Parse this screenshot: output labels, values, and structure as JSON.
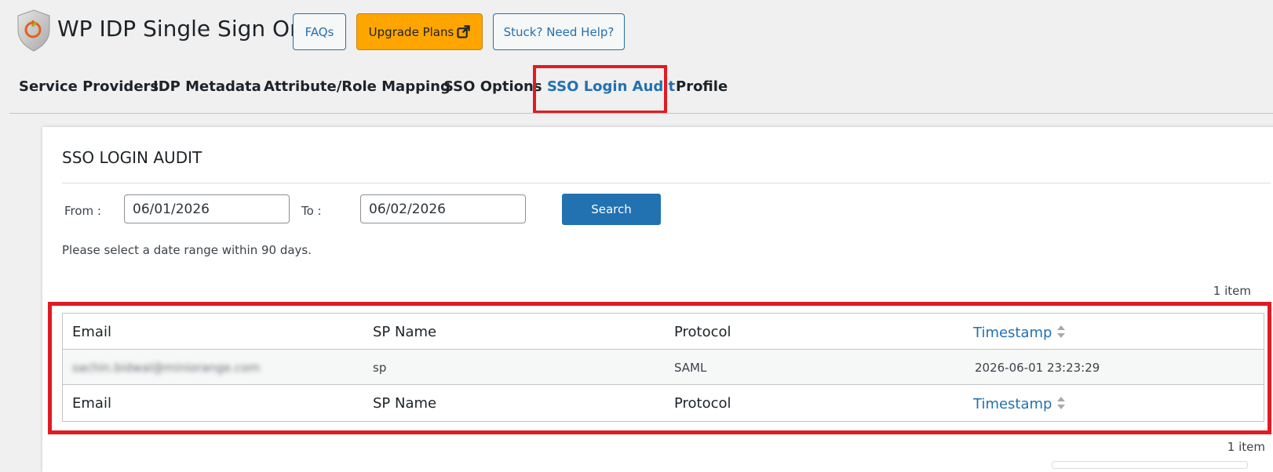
{
  "header": {
    "app_title": "WP IDP Single Sign On",
    "faqs_label": "FAQs",
    "upgrade_label": "Upgrade Plans",
    "help_label": "Stuck? Need Help?",
    "brand_color": "#ffa500"
  },
  "tabs": [
    {
      "label": "Service Providers",
      "active": false
    },
    {
      "label": "IDP Metadata",
      "active": false
    },
    {
      "label": "Attribute/Role Mapping",
      "active": false
    },
    {
      "label": "SSO Options",
      "active": false
    },
    {
      "label": "SSO Login Audit",
      "active": true
    },
    {
      "label": "Profile",
      "active": false
    }
  ],
  "audit": {
    "title": "SSO LOGIN AUDIT",
    "from_label": "From :",
    "from_value": "06/01/2026",
    "to_label": "To :",
    "to_value": "06/02/2026",
    "search_label": "Search",
    "hint": "Please select a date range within 90 days.",
    "count_top": "1 item",
    "count_bottom": "1 item"
  },
  "table": {
    "columns": [
      "Email",
      "SP Name",
      "Protocol",
      "Timestamp"
    ],
    "rows": [
      {
        "email": "sachin.bidwal@miniorange.com",
        "sp_name": "sp",
        "protocol": "SAML",
        "timestamp": "2026-06-01 23:23:29"
      }
    ]
  },
  "colors": {
    "accent": "#2271b1",
    "highlight": "#e11b22"
  }
}
